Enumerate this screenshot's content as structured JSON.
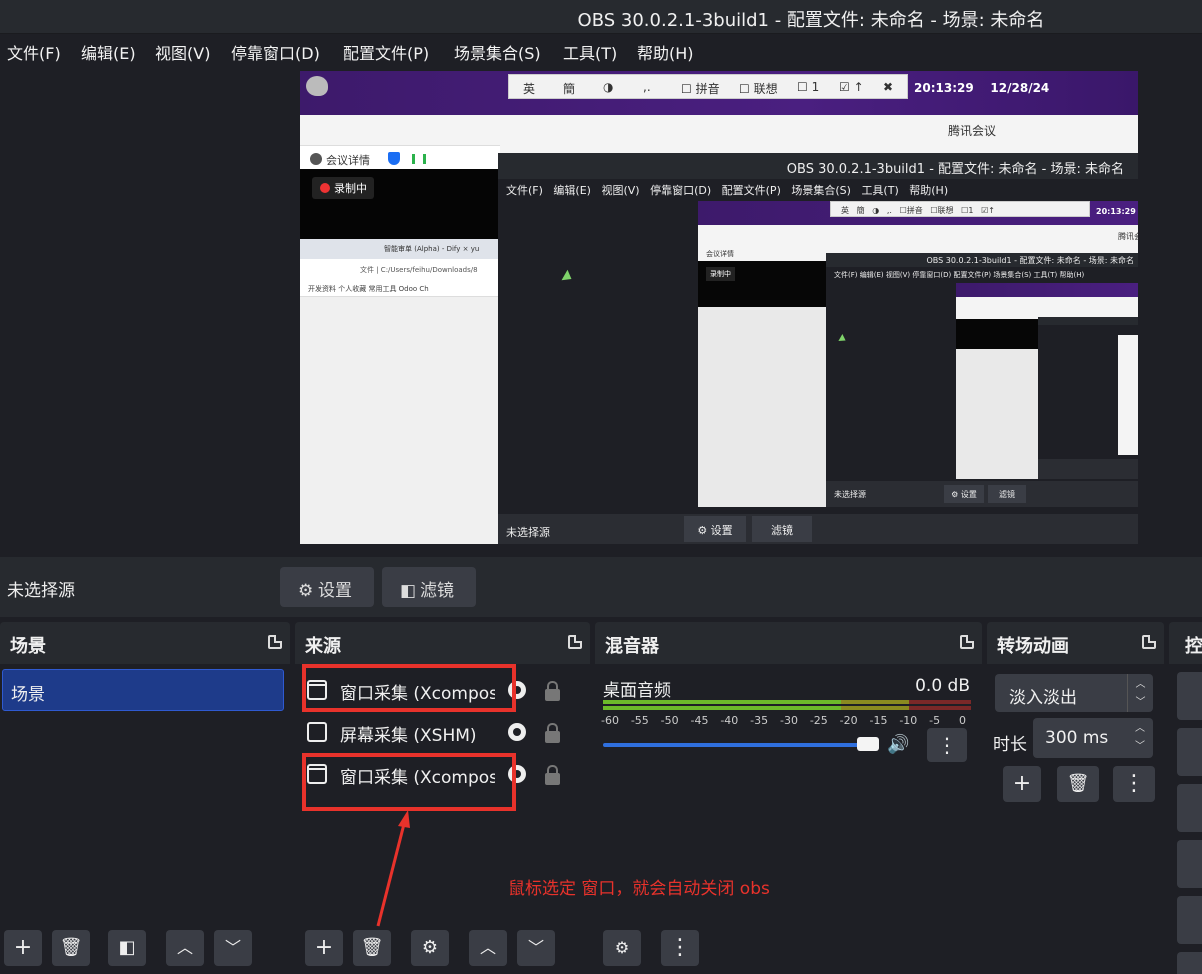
{
  "window": {
    "title": "OBS 30.0.2.1-3build1 - 配置文件: 未命名 - 场景: 未命名"
  },
  "menu": [
    "文件(F)",
    "编辑(E)",
    "视图(V)",
    "停靠窗口(D)",
    "配置文件(P)",
    "场景集合(S)",
    "工具(T)",
    "帮助(H)"
  ],
  "preview": {
    "ime": [
      "英",
      "簡",
      "◑",
      ",.",
      "☐ 拼音",
      "☐ 联想",
      "☐ 1",
      "☑ ↑",
      "✖"
    ],
    "clock_time": "20:13:29",
    "clock_date": "12/28/24",
    "tencent_label": "腾讯会议",
    "meeting_details": "会议详情",
    "recording": "录制中",
    "browser_tabs": "智能审单 (Alpha) - Dify  ×  yu",
    "browser_address": "文件 | C:/Users/feihu/Downloads/8",
    "bookmarks": "开发资料  个人收藏  常用工具  Odoo  Ch",
    "nested_title": "OBS 30.0.2.1-3build1 - 配置文件: 未命名 - 场景: 未命名",
    "nested_no_source": "未选择源",
    "nested_settings": "⚙ 设置",
    "nested_filters": "滤镜"
  },
  "source_toolbar": {
    "no_source": "未选择源",
    "settings": "设置",
    "filters": "滤镜"
  },
  "scenes": {
    "title": "场景",
    "items": [
      "场景"
    ]
  },
  "sources": {
    "title": "来源",
    "items": [
      {
        "name": "窗口采集 (Xcomposite)",
        "type": "window"
      },
      {
        "name": "屏幕采集 (XSHM)",
        "type": "screen"
      },
      {
        "name": "窗口采集 (Xcomposite)",
        "type": "window"
      }
    ]
  },
  "annotation": "鼠标选定 窗口，就会自动关闭 obs",
  "mixer": {
    "title": "混音器",
    "channel": "桌面音频",
    "db": "0.0 dB",
    "ticks": [
      "-60",
      "-55",
      "-50",
      "-45",
      "-40",
      "-35",
      "-30",
      "-25",
      "-20",
      "-15",
      "-10",
      "-5",
      "0"
    ],
    "volume_fraction": 0.97
  },
  "transitions": {
    "title": "转场动画",
    "selected": "淡入淡出",
    "duration_label": "时长",
    "duration_value": "300 ms"
  },
  "controls": {
    "title": "控"
  },
  "colors": {
    "accent_blue": "#2f6fde",
    "annotation_red": "#e8322b",
    "dock_bg": "#272a2f"
  }
}
